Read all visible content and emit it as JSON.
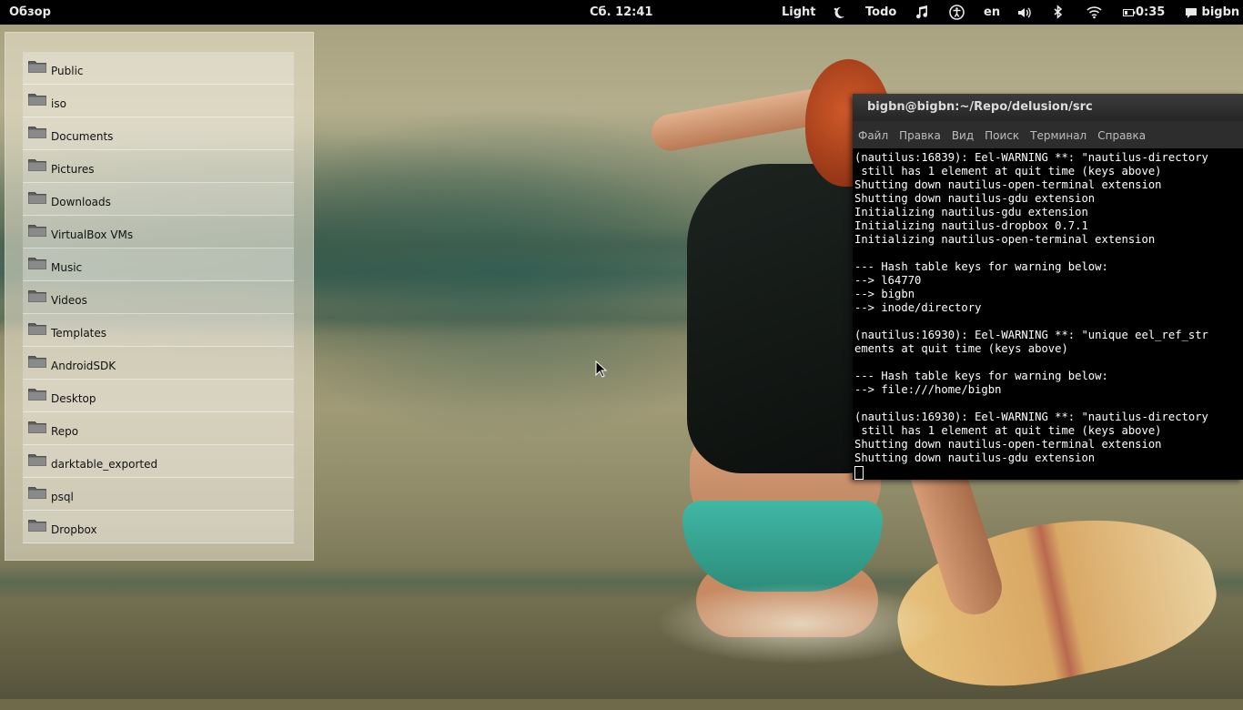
{
  "topbar": {
    "overview_label": "Обзор",
    "clock": "Сб. 12:41",
    "theme_label": "Light",
    "todo_label": "Todo",
    "language": "en",
    "battery_time": "0:35",
    "user": "bigbn"
  },
  "places": {
    "items": [
      {
        "label": "Public"
      },
      {
        "label": "iso"
      },
      {
        "label": "Documents"
      },
      {
        "label": "Pictures"
      },
      {
        "label": "Downloads"
      },
      {
        "label": "VirtualBox VMs"
      },
      {
        "label": "Music"
      },
      {
        "label": "Videos"
      },
      {
        "label": "Templates"
      },
      {
        "label": "AndroidSDK"
      },
      {
        "label": "Desktop"
      },
      {
        "label": "Repo"
      },
      {
        "label": "darktable_exported"
      },
      {
        "label": "psql"
      },
      {
        "label": "Dropbox"
      }
    ]
  },
  "terminal": {
    "title": "bigbn@bigbn:~/Repo/delusion/src",
    "menu": [
      "Файл",
      "Правка",
      "Вид",
      "Поиск",
      "Терминал",
      "Справка"
    ],
    "lines": [
      "(nautilus:16839): Eel-WARNING **: \"nautilus-directory",
      " still has 1 element at quit time (keys above)",
      "Shutting down nautilus-open-terminal extension",
      "Shutting down nautilus-gdu extension",
      "Initializing nautilus-gdu extension",
      "Initializing nautilus-dropbox 0.7.1",
      "Initializing nautilus-open-terminal extension",
      "",
      "--- Hash table keys for warning below:",
      "--> l64770",
      "--> bigbn",
      "--> inode/directory",
      "",
      "(nautilus:16930): Eel-WARNING **: \"unique eel_ref_str",
      "ements at quit time (keys above)",
      "",
      "--- Hash table keys for warning below:",
      "--> file:///home/bigbn",
      "",
      "(nautilus:16930): Eel-WARNING **: \"nautilus-directory",
      " still has 1 element at quit time (keys above)",
      "Shutting down nautilus-open-terminal extension",
      "Shutting down nautilus-gdu extension"
    ]
  },
  "icons": {
    "night-light": "moon-sun-icon",
    "music": "music-note-icon",
    "accessibility": "accessibility-icon",
    "volume": "speaker-icon",
    "bluetooth": "bluetooth-icon",
    "wifi": "wifi-icon",
    "battery": "battery-icon",
    "chat": "chat-bubble-icon"
  }
}
